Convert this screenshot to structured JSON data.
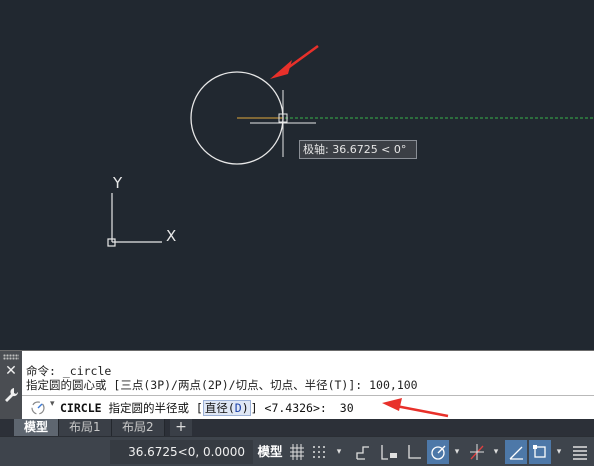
{
  "tooltip": {
    "label": "极轴: 36.6725 < 0°"
  },
  "ucs": {
    "y_label": "Y",
    "x_label": "X"
  },
  "command_window": {
    "history": [
      "命令: _circle",
      "指定圆的圆心或 [三点(3P)/两点(2P)/切点、切点、半径(T)]: 100,100"
    ],
    "prompt": {
      "command": "CIRCLE",
      "text": " 指定圆的半径或 ",
      "bracket_open": "[",
      "option_label": "直径",
      "option_key_open": "(",
      "option_key": "D",
      "option_key_close": ")",
      "bracket_close": "]",
      "default": " <7.4326>: ",
      "input": "30"
    }
  },
  "layout_tabs": [
    {
      "label": "模型",
      "active": true
    },
    {
      "label": "布局1",
      "active": false
    },
    {
      "label": "布局2",
      "active": false
    }
  ],
  "layout_add": "+",
  "status_bar": {
    "coordinates": "36.6725<0, 0.0000",
    "model_label": "模型",
    "buttons": [
      {
        "icon": "grid-icon",
        "on": false
      },
      {
        "icon": "snap-mode-icon",
        "on": false
      },
      {
        "icon": "infer-constraints-icon",
        "on": false
      },
      {
        "icon": "dynamic-input-icon",
        "on": false
      },
      {
        "icon": "ortho-icon",
        "on": false
      },
      {
        "icon": "polar-tracking-icon",
        "on": true
      },
      {
        "icon": "isodraft-icon",
        "on": false
      },
      {
        "icon": "object-snap-tracking-icon",
        "on": true
      },
      {
        "icon": "object-snap-icon",
        "on": true
      },
      {
        "icon": "customization-icon",
        "on": false
      }
    ]
  },
  "colors": {
    "canvas_bg": "#212830",
    "circle": "#e8e8e8",
    "tracking_line": "#38b24a",
    "radius_line": "#e0a93c",
    "arrow_annotation": "#e8302a",
    "status_active": "#4d78a8"
  }
}
